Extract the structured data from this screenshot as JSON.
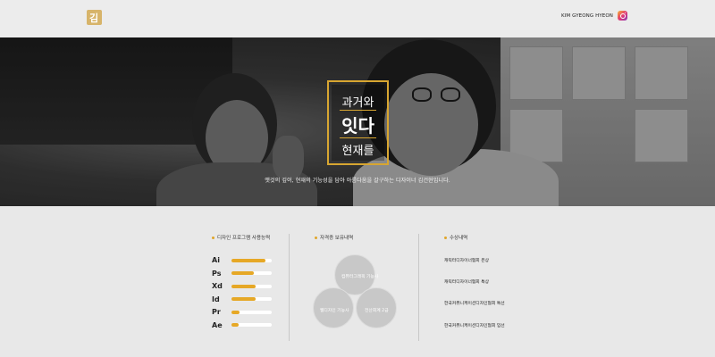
{
  "header": {
    "logo_text": "김",
    "name": "KIM GYEONG HYEON",
    "instagram_icon": "instagram-icon"
  },
  "hero": {
    "title_line1": "과거와",
    "title_line2": "잇다",
    "title_line3": "현재를",
    "description": "옛것의 깊이, 현재의 기능성을 담아 아름다움을 갈구하는 디자이너 김건현입니다."
  },
  "skills": {
    "title": "디자인 프로그램 사용능력",
    "items": [
      {
        "name": "Ai",
        "level": 0.85
      },
      {
        "name": "Ps",
        "level": 0.55
      },
      {
        "name": "Xd",
        "level": 0.6
      },
      {
        "name": "Id",
        "level": 0.6
      },
      {
        "name": "Pr",
        "level": 0.2
      },
      {
        "name": "Ae",
        "level": 0.18
      }
    ]
  },
  "certificates": {
    "title": "자격증 보유내역",
    "items": [
      "컴퓨터그래픽 기능사",
      "웹디자인 기능사",
      "전산회계 2급"
    ]
  },
  "awards": {
    "title": "수상내역",
    "items": [
      "캐릭터디자이너협회 은상",
      "캐릭터디자이너협회 특상",
      "한국커뮤니케이션디자인협회 특선",
      "한국커뮤니케이션디자인협회 입선"
    ]
  },
  "colors": {
    "accent": "#e6a826",
    "gold": "#d8a631"
  }
}
